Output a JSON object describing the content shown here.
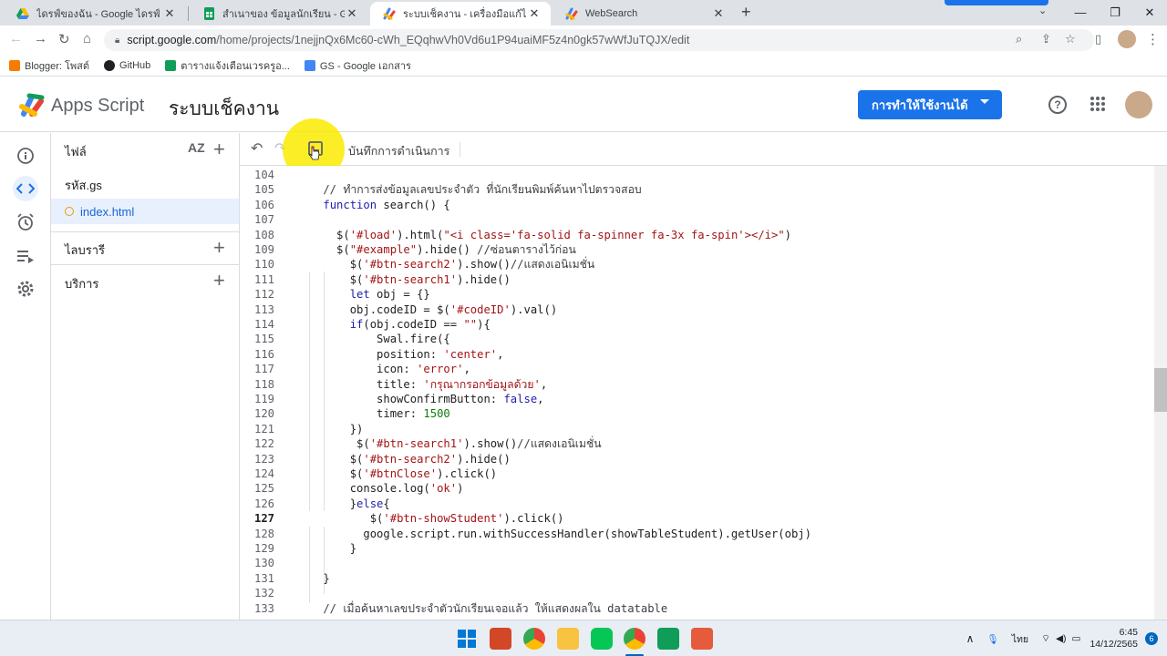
{
  "browser": {
    "tabs": [
      {
        "title": "ไดรฟ์ของฉัน - Google ไดรฟ์",
        "icon": "drive-icon"
      },
      {
        "title": "สำเนาของ ข้อมูลนักเรียน - Google ชี",
        "icon": "sheets-icon"
      },
      {
        "title": "ระบบเช็คงาน - เครื่องมือแก้ไขโครงการ",
        "icon": "apps-script-icon",
        "active": true
      },
      {
        "title": "WebSearch",
        "icon": "apps-script-icon"
      }
    ],
    "url_host": "script.google.com",
    "url_path": "/home/projects/1nejjnQx6Mc60-cWh_EQqhwVh0Vd6u1P94uaiMF5z4n0gk57wWfJuTQJX/edit",
    "bookmarks": [
      {
        "label": "Blogger: โพสต์",
        "color": "#f57c00"
      },
      {
        "label": "GitHub",
        "color": "#202124"
      },
      {
        "label": "ตารางแจ้งเตือนเวรครูอ...",
        "color": "#0f9d58"
      },
      {
        "label": "GS - Google เอกสาร",
        "color": "#4285f4"
      }
    ]
  },
  "app": {
    "name": "Apps Script",
    "project": "ระบบเช็คงาน",
    "deploy_label": "การทำให้ใช้งานได้",
    "brand_color": "#1a73e8"
  },
  "sidebar": {
    "files_label": "ไฟล์",
    "sort_label": "AZ",
    "files": [
      {
        "name": "รหัส.gs",
        "selected": false
      },
      {
        "name": "index.html",
        "selected": true
      }
    ],
    "libraries_label": "ไลบรารี",
    "services_label": "บริการ"
  },
  "editor": {
    "run_log_label": "บันทึกการดำเนินการ",
    "current_line": 127,
    "lines": [
      {
        "n": "104",
        "t": ""
      },
      {
        "n": "105",
        "t": "    // ทำการส่งข้อมูลเลขประจำตัว ที่นักเรียนพิมพ์ค้นหาไปตรวจสอบ"
      },
      {
        "n": "106",
        "t": "    function search() {"
      },
      {
        "n": "107",
        "t": ""
      },
      {
        "n": "108",
        "t": "      $('#load').html(\"<i class='fa-solid fa-spinner fa-3x fa-spin'></i>\")"
      },
      {
        "n": "109",
        "t": "      $(\"#example\").hide() //ซ่อนตารางไว้ก่อน"
      },
      {
        "n": "110",
        "t": "        $('#btn-search2').show()//แสดงเอนิเมชั่น"
      },
      {
        "n": "111",
        "t": "        $('#btn-search1').hide()"
      },
      {
        "n": "112",
        "t": "        let obj = {}"
      },
      {
        "n": "113",
        "t": "        obj.codeID = $('#codeID').val()"
      },
      {
        "n": "114",
        "t": "        if(obj.codeID == \"\"){"
      },
      {
        "n": "115",
        "t": "            Swal.fire({"
      },
      {
        "n": "116",
        "t": "            position: 'center',"
      },
      {
        "n": "117",
        "t": "            icon: 'error',"
      },
      {
        "n": "118",
        "t": "            title: 'กรุณากรอกข้อมูลด้วย',"
      },
      {
        "n": "119",
        "t": "            showConfirmButton: false,"
      },
      {
        "n": "120",
        "t": "            timer: 1500"
      },
      {
        "n": "121",
        "t": "        })"
      },
      {
        "n": "122",
        "t": "         $('#btn-search1').show()//แสดงเอนิเมชั่น"
      },
      {
        "n": "123",
        "t": "        $('#btn-search2').hide()"
      },
      {
        "n": "124",
        "t": "        $('#btnClose').click()"
      },
      {
        "n": "125",
        "t": "        console.log('ok')"
      },
      {
        "n": "126",
        "t": "        }else{"
      },
      {
        "n": "127",
        "t": "           $('#btn-showStudent').click()"
      },
      {
        "n": "128",
        "t": "          google.script.run.withSuccessHandler(showTableStudent).getUser(obj)"
      },
      {
        "n": "129",
        "t": "        }"
      },
      {
        "n": "130",
        "t": ""
      },
      {
        "n": "131",
        "t": "    }"
      },
      {
        "n": "132",
        "t": ""
      },
      {
        "n": "133",
        "t": "    // เมื่อค้นหาเลขประจำตัวนักเรียนเจอแล้ว ให้แสดงผลใน datatable"
      }
    ]
  },
  "taskbar": {
    "lang": "ไทย",
    "time": "6:45",
    "date": "14/12/2565",
    "notif_count": "6"
  }
}
